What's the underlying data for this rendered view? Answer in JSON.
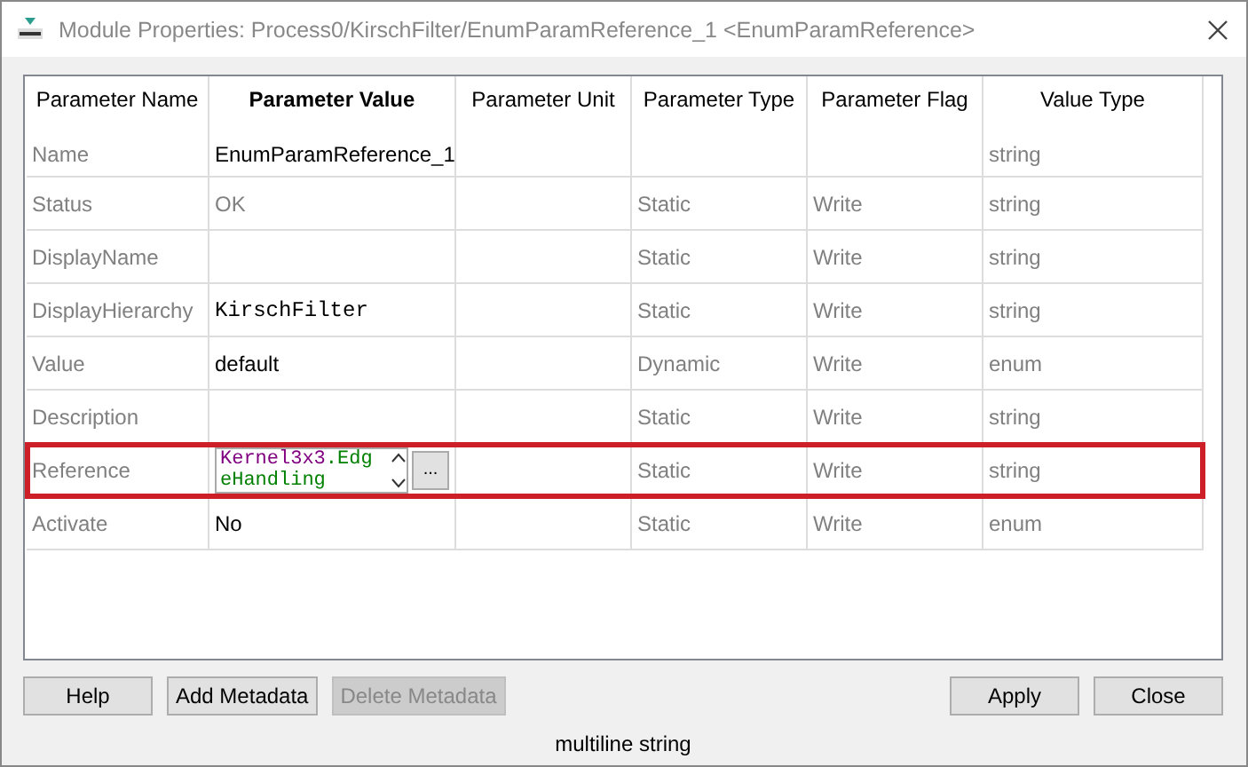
{
  "window": {
    "title": "Module Properties: Process0/KirschFilter/EnumParamReference_1 <EnumParamReference>"
  },
  "table": {
    "columns": [
      "Parameter Name",
      "Parameter Value",
      "Parameter Unit",
      "Parameter Type",
      "Parameter Flag",
      "Value Type"
    ],
    "rows": [
      {
        "name": "Name",
        "kind": "text",
        "value": "EnumParamReference_1",
        "readonly": false,
        "type": "",
        "flag": "",
        "value_type": "string",
        "selected": false
      },
      {
        "name": "Status",
        "kind": "text",
        "value": "OK",
        "readonly": true,
        "type": "Static",
        "flag": "Write",
        "value_type": "string",
        "selected": false
      },
      {
        "name": "DisplayName",
        "kind": "empty",
        "type": "Static",
        "flag": "Write",
        "value_type": "string",
        "selected": false
      },
      {
        "name": "DisplayHierarchy",
        "kind": "mono",
        "value": "KirschFilter",
        "readonly": false,
        "type": "Static",
        "flag": "Write",
        "value_type": "string",
        "selected": false
      },
      {
        "name": "Value",
        "kind": "text",
        "value": "default",
        "readonly": false,
        "type": "Dynamic",
        "flag": "Write",
        "value_type": "enum",
        "selected": false
      },
      {
        "name": "Description",
        "kind": "empty",
        "type": "Static",
        "flag": "Write",
        "value_type": "string",
        "selected": false
      },
      {
        "name": "Reference",
        "kind": "editor",
        "tokens": [
          {
            "text": "Kernel3x3",
            "color": "#800080"
          },
          {
            "text": ".EdgeHandling",
            "color": "#008000"
          }
        ],
        "browse_button": "...",
        "type": "Static",
        "flag": "Write",
        "value_type": "string",
        "selected": true
      },
      {
        "name": "Activate",
        "kind": "text",
        "value": "No",
        "readonly": false,
        "type": "Static",
        "flag": "Write",
        "value_type": "enum",
        "selected": false
      }
    ]
  },
  "buttons_left": [
    {
      "label": "Help",
      "disabled": false
    },
    {
      "label": "Add Metadata",
      "disabled": false
    },
    {
      "label": "Delete Metadata",
      "disabled": true
    }
  ],
  "buttons_right": [
    {
      "label": "Apply",
      "disabled": false
    },
    {
      "label": "Close",
      "disabled": false
    }
  ],
  "status_bar": "multiline string"
}
